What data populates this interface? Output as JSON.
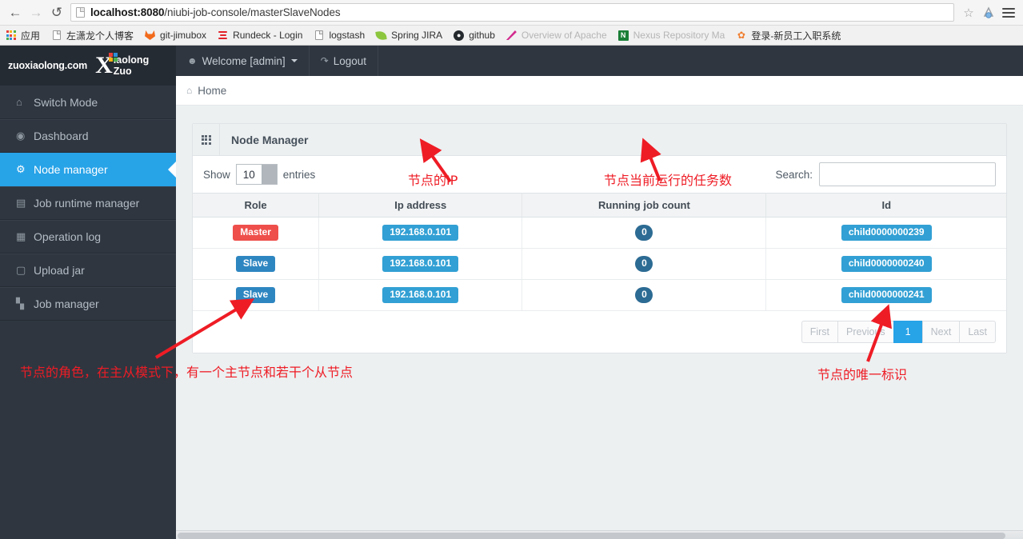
{
  "browser": {
    "back_icon": "back-arrow-icon",
    "forward_icon": "forward-arrow-icon",
    "reload_icon": "reload-icon",
    "url_host": "localhost:8080",
    "url_path": "/niubi-job-console/masterSlaveNodes",
    "url_full": "localhost:8080/niubi-job-console/masterSlaveNodes",
    "star_icon": "bookmark-star-icon",
    "menu_icon": "hamburger-menu-icon",
    "bookmarks": [
      {
        "label": "应用",
        "icon": "apps-grid-icon"
      },
      {
        "label": "左潇龙个人博客",
        "icon": "document-icon"
      },
      {
        "label": "git-jimubox",
        "icon": "gitlab-fox-icon"
      },
      {
        "label": "Rundeck - Login",
        "icon": "rundeck-icon"
      },
      {
        "label": "logstash",
        "icon": "document-icon"
      },
      {
        "label": "Spring JIRA",
        "icon": "spring-leaf-icon"
      },
      {
        "label": "github",
        "icon": "github-icon"
      },
      {
        "label": "Overview of Apache",
        "icon": "apache-icon"
      },
      {
        "label": "Nexus Repository Ma",
        "icon": "nexus-icon"
      },
      {
        "label": "登录-新员工入职系统",
        "icon": "flower-icon"
      }
    ]
  },
  "brand": {
    "site": "zuoxiaolong.com",
    "logo_letter": "X",
    "logo_name": "iaolong Zuo",
    "logo_colors": [
      "#e8413a",
      "#2d8fd8",
      "#f5b315",
      "#4caf50"
    ]
  },
  "sidebar": {
    "items": [
      {
        "label": "Switch Mode",
        "icon": "home-icon",
        "active": false
      },
      {
        "label": "Dashboard",
        "icon": "dashboard-icon",
        "active": false
      },
      {
        "label": "Node manager",
        "icon": "gear-icon",
        "active": true
      },
      {
        "label": "Job runtime manager",
        "icon": "briefcase-icon",
        "active": false
      },
      {
        "label": "Operation log",
        "icon": "grid-icon",
        "active": false
      },
      {
        "label": "Upload jar",
        "icon": "upload-box-icon",
        "active": false
      },
      {
        "label": "Job manager",
        "icon": "bar-chart-icon",
        "active": false
      }
    ]
  },
  "topbar": {
    "welcome": "Welcome [admin]",
    "welcome_icon": "user-icon",
    "logout": "Logout",
    "logout_icon": "sign-out-icon"
  },
  "breadcrumb": {
    "icon": "home-icon",
    "text": "Home"
  },
  "panel": {
    "header_icon": "th-grid-icon",
    "title": "Node Manager"
  },
  "table_tools": {
    "show_label": "Show",
    "entries_label": "entries",
    "page_length": "10",
    "search_label": "Search:",
    "search_value": "",
    "search_placeholder": ""
  },
  "table": {
    "columns": [
      "Role",
      "Ip address",
      "Running job count",
      "Id"
    ],
    "rows": [
      {
        "role": "Master",
        "role_style": "danger",
        "ip": "192.168.0.101",
        "running_job_count": "0",
        "id": "child0000000239"
      },
      {
        "role": "Slave",
        "role_style": "primary",
        "ip": "192.168.0.101",
        "running_job_count": "0",
        "id": "child0000000240"
      },
      {
        "role": "Slave",
        "role_style": "primary",
        "ip": "192.168.0.101",
        "running_job_count": "0",
        "id": "child0000000241"
      }
    ]
  },
  "pagination": {
    "first": "First",
    "previous": "Previous",
    "current": "1",
    "next": "Next",
    "last": "Last"
  },
  "annotations": [
    {
      "name": "annotation-node-ip",
      "text": "节点的IP"
    },
    {
      "name": "annotation-running-job-count",
      "text": "节点当前运行的任务数"
    },
    {
      "name": "annotation-node-role",
      "text": "节点的角色，在主从模式下，有一个主节点和若干个从节点"
    },
    {
      "name": "annotation-node-id",
      "text": "节点的唯一标识"
    }
  ],
  "colors": {
    "accent": "#27a3e8",
    "sidebar_bg": "#2f3640",
    "danger": "#ef4f4b",
    "primary": "#2e86c1",
    "info": "#32a0d4",
    "badge": "#2c6b93",
    "annotation": "#ee1c25"
  }
}
